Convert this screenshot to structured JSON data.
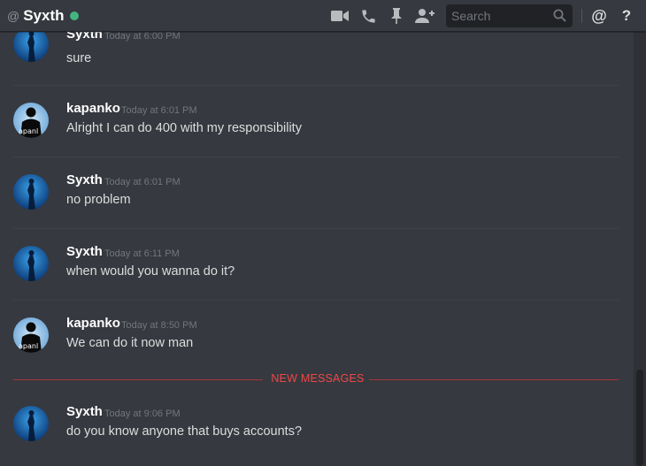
{
  "header": {
    "at_symbol": "@",
    "title": "Syxth",
    "status_color": "#43b581",
    "search": {
      "placeholder": "Search",
      "value": ""
    },
    "icons": [
      "video-call-icon",
      "voice-call-icon",
      "pin-icon",
      "add-friend-icon",
      "search-icon",
      "mentions-icon",
      "help-icon"
    ]
  },
  "messages": [
    {
      "author": "Syxth",
      "timestamp": "Today at 6:00 PM",
      "content": "sure",
      "avatar": "syxth"
    },
    {
      "author": "kapanko",
      "timestamp": "Today at 6:01 PM",
      "content": "Alright I can do 400 with my responsibility",
      "avatar": "kapanko"
    },
    {
      "author": "Syxth",
      "timestamp": "Today at 6:01 PM",
      "content": "no problem",
      "avatar": "syxth"
    },
    {
      "author": "Syxth",
      "timestamp": "Today at 6:11 PM",
      "content": "when would you wanna do it?",
      "avatar": "syxth"
    },
    {
      "author": "kapanko",
      "timestamp": "Today at 8:50 PM",
      "content": "We can do it now man",
      "avatar": "kapanko"
    },
    {
      "author": "Syxth",
      "timestamp": "Today at 9:06 PM",
      "content": "do you know anyone that buys accounts?",
      "avatar": "syxth"
    }
  ],
  "new_messages_label": "NEW MESSAGES",
  "avatar_texts": {
    "kapanko": "apanl"
  },
  "colors": {
    "background": "#36393f",
    "header_text": "#ffffff",
    "new_messages": "#f04747",
    "timestamp": "#72767d",
    "message_text": "#dcddde"
  }
}
